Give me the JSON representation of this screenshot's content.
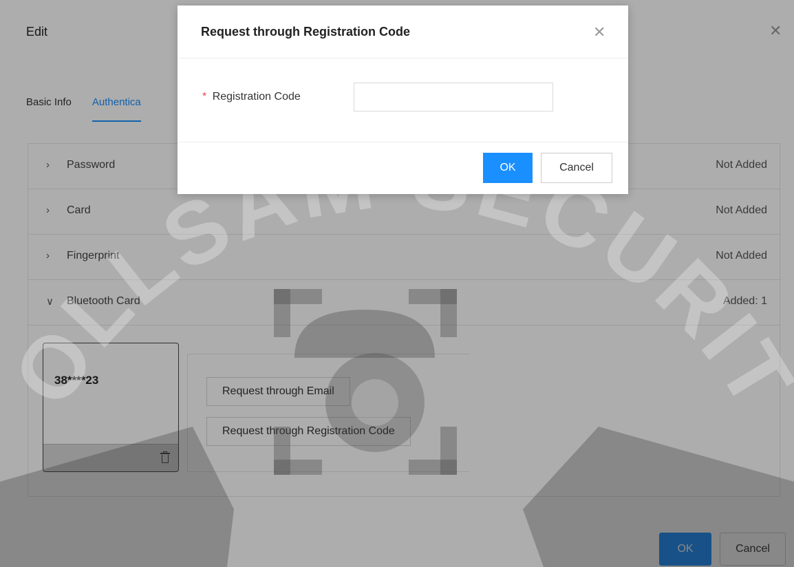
{
  "edit_dialog": {
    "title": "Edit",
    "close_glyph": "✕",
    "tabs": [
      {
        "label": "Basic Info",
        "active": false
      },
      {
        "label": "Authentica",
        "active": true
      }
    ],
    "sections": [
      {
        "chevron": "›",
        "label": "Password",
        "status": "Not Added",
        "expanded": false
      },
      {
        "chevron": "›",
        "label": "Card",
        "status": "Not Added",
        "expanded": false
      },
      {
        "chevron": "›",
        "label": "Fingerprint",
        "status": "Not Added",
        "expanded": false
      },
      {
        "chevron": "∨",
        "label": "Bluetooth Card",
        "status": "Added: 1",
        "expanded": true
      }
    ],
    "bluetooth_card": {
      "number": "38****23",
      "delete_icon": "trash-icon"
    },
    "request_buttons": {
      "email": "Request through Email",
      "registration_code": "Request through Registration Code"
    },
    "footer": {
      "ok_label": "OK",
      "cancel_label": "Cancel"
    }
  },
  "modal": {
    "title": "Request through Registration Code",
    "close_glyph": "✕",
    "field": {
      "required_mark": "*",
      "label": "Registration Code",
      "value": "",
      "placeholder": ""
    },
    "ok_label": "OK",
    "cancel_label": "Cancel"
  },
  "watermark": {
    "text": "COLLSAM SECURITY"
  },
  "colors": {
    "accent": "#1a8fff",
    "required": "#e5484d",
    "overlay": "rgba(0,0,0,0.32)"
  }
}
